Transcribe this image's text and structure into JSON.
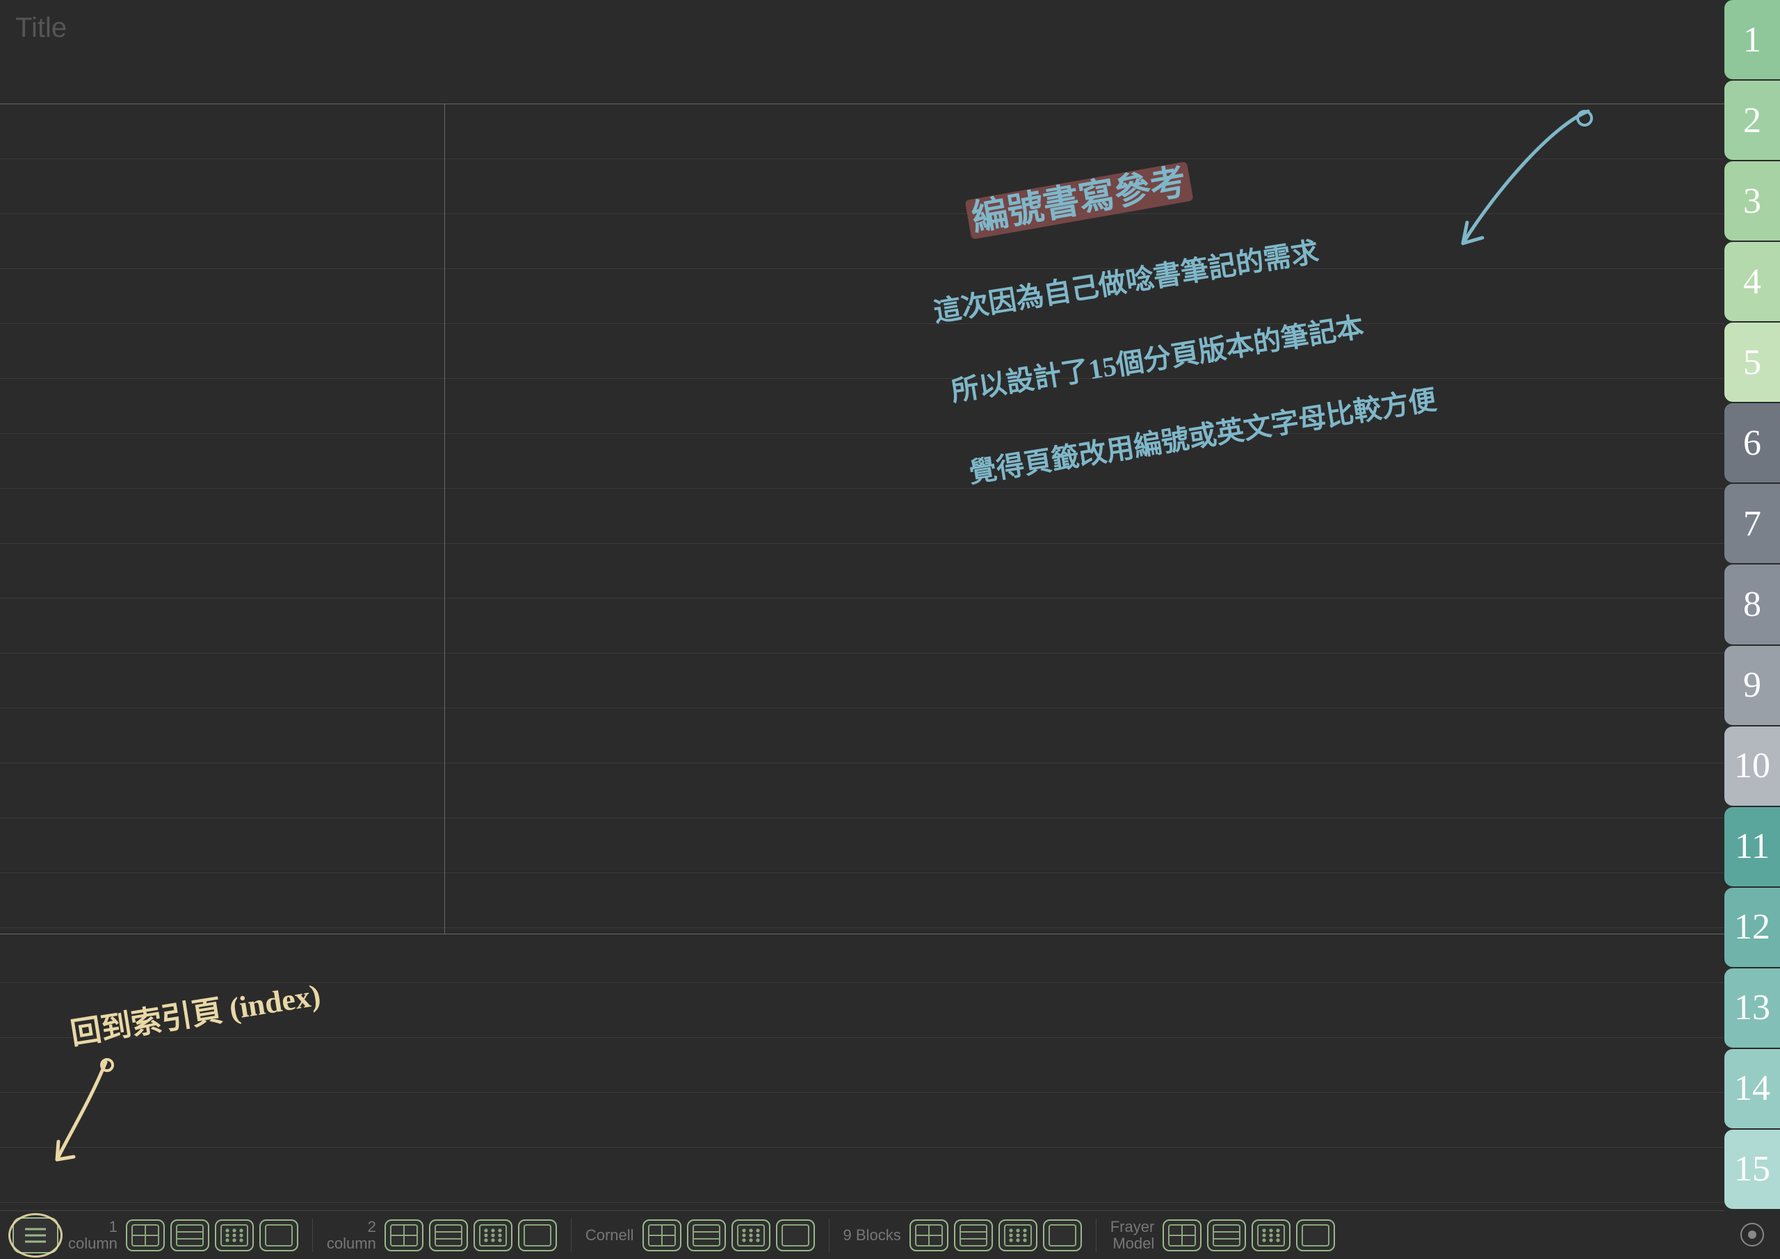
{
  "title": {
    "placeholder": "Title"
  },
  "handwriting": {
    "heading": "編號書寫參考",
    "line1": "這次因為自己做唸書筆記的需求",
    "line2": "所以設計了15個分頁版本的筆記本",
    "line3": "覺得頁籤改用編號或英文字母比較方便",
    "index_label": "回到索引頁 (index)"
  },
  "tabs": [
    {
      "label": "1",
      "color": "#8fc79b"
    },
    {
      "label": "2",
      "color": "#a0cfa3"
    },
    {
      "label": "3",
      "color": "#a7d2a3"
    },
    {
      "label": "4",
      "color": "#b4d9ac"
    },
    {
      "label": "5",
      "color": "#c6e2bb"
    },
    {
      "label": "6",
      "color": "#6f7680"
    },
    {
      "label": "7",
      "color": "#7a818b"
    },
    {
      "label": "8",
      "color": "#888f98"
    },
    {
      "label": "9",
      "color": "#9aa0a8"
    },
    {
      "label": "10",
      "color": "#b3b8bf"
    },
    {
      "label": "11",
      "color": "#5aa69c"
    },
    {
      "label": "12",
      "color": "#6fb3aa"
    },
    {
      "label": "13",
      "color": "#82bfb6"
    },
    {
      "label": "14",
      "color": "#97ccc4"
    },
    {
      "label": "15",
      "color": "#aedad3"
    }
  ],
  "toolbar": {
    "groups": [
      {
        "label_line1": "1",
        "label_line2": "column",
        "variants": [
          "grid",
          "rows",
          "dots",
          "blank"
        ]
      },
      {
        "label_line1": "2",
        "label_line2": "column",
        "variants": [
          "grid",
          "rows",
          "dots",
          "blank"
        ]
      },
      {
        "label_line1": "Cornell",
        "label_line2": "",
        "variants": [
          "grid",
          "rows",
          "dots",
          "blank"
        ]
      },
      {
        "label_line1": "9 Blocks",
        "label_line2": "",
        "variants": [
          "grid",
          "rows",
          "dots",
          "blank"
        ]
      },
      {
        "label_line1": "Frayer",
        "label_line2": "Model",
        "variants": [
          "grid",
          "rows",
          "dots",
          "blank"
        ]
      }
    ]
  }
}
